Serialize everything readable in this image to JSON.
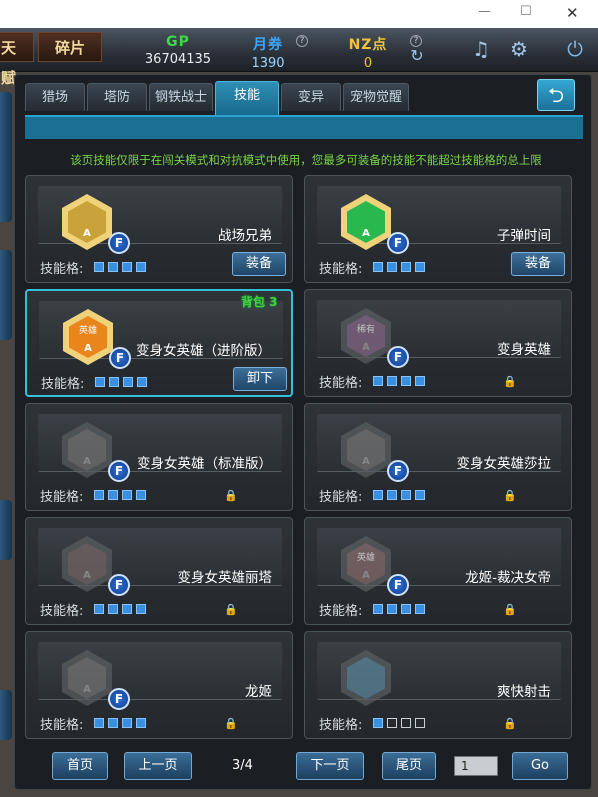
{
  "window": {
    "minimize": "—",
    "maximize": "☐",
    "close": "✕"
  },
  "topbar": {
    "left_tab_partial": "天赋",
    "shard_tab": "碎片",
    "gp": {
      "label": "GP",
      "value": "36704135",
      "color": "#3fd74a"
    },
    "points": {
      "label": "月券",
      "value": "1390",
      "color": "#3aa6ff"
    },
    "nz": {
      "label": "NZ点",
      "value": "0",
      "color": "#f3c23b"
    },
    "help": "?"
  },
  "tabs": [
    "猎场",
    "塔防",
    "钢铁战士",
    "技能",
    "变异",
    "宠物觉醒"
  ],
  "active_tab": "技能",
  "back_icon": "⮌",
  "notice": "该页技能仅限于在闯关模式和对抗模式中使用，您最多可装备的技能不能超过技能格的总上限",
  "slot_label": "技能格:",
  "badge_letter": "F",
  "rank_letter": "A",
  "cards": [
    {
      "name": "战场兄弟",
      "slots": [
        1,
        1,
        1,
        1
      ],
      "action": "装备",
      "locked": false,
      "icon": "brothers-skill-icon",
      "color": "#c9a33a",
      "disabled": false
    },
    {
      "name": "子弹时间",
      "slots": [
        1,
        1,
        1,
        1
      ],
      "action": "装备",
      "locked": false,
      "icon": "bullet-time-skill-icon",
      "color": "#29b84e",
      "disabled": false
    },
    {
      "name": "变身女英雄（进阶版）",
      "slots": [
        1,
        1,
        1,
        1
      ],
      "action": "卸下",
      "locked": false,
      "icon": "heroine-advanced-skill-icon",
      "color": "#e8861c",
      "disabled": false,
      "bag": "背包 3",
      "hex_text": "英雄"
    },
    {
      "name": "变身英雄",
      "slots": [
        1,
        1,
        1,
        1
      ],
      "action": "",
      "locked": true,
      "icon": "hero-transform-skill-icon",
      "color": "#8a6a8a",
      "disabled": true,
      "hex_text": "稀有"
    },
    {
      "name": "变身女英雄（标准版）",
      "slots": [
        1,
        1,
        1,
        1
      ],
      "action": "",
      "locked": true,
      "icon": "heroine-standard-skill-icon",
      "color": "#777777",
      "disabled": true
    },
    {
      "name": "变身女英雄莎拉",
      "slots": [
        1,
        1,
        1,
        1
      ],
      "action": "",
      "locked": true,
      "icon": "heroine-sarah-skill-icon",
      "color": "#777777",
      "disabled": true
    },
    {
      "name": "变身女英雄丽塔",
      "slots": [
        1,
        1,
        1,
        1
      ],
      "action": "",
      "locked": true,
      "icon": "heroine-rita-skill-icon",
      "color": "#7a6a6a",
      "disabled": true
    },
    {
      "name": "龙姬-裁决女帝",
      "slots": [
        1,
        1,
        1,
        1
      ],
      "action": "",
      "locked": true,
      "icon": "dragon-empress-skill-icon",
      "color": "#8a6e6e",
      "disabled": true,
      "hex_text": "英雄"
    },
    {
      "name": "龙姬",
      "slots": [
        1,
        1,
        1,
        1
      ],
      "action": "",
      "locked": true,
      "icon": "dragon-princess-skill-icon",
      "color": "#777777",
      "disabled": true
    },
    {
      "name": "爽快射击",
      "slots": [
        1,
        0,
        0,
        0
      ],
      "action": "",
      "locked": true,
      "icon": "rapid-shot-skill-icon",
      "color": "#5f8aa0",
      "disabled": true,
      "no_badge": true
    }
  ],
  "pager": {
    "first": "首页",
    "prev": "上一页",
    "indicator": "3/4",
    "next": "下一页",
    "last": "尾页",
    "input_value": "1",
    "go": "Go"
  },
  "accent_color": "#35bfd9"
}
